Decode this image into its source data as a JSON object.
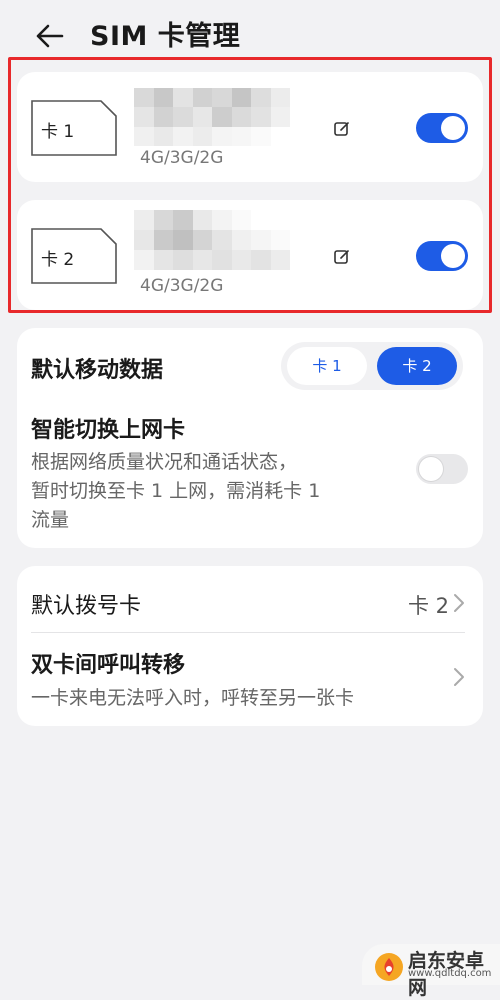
{
  "header": {
    "title": "SIM 卡管理"
  },
  "sims": [
    {
      "chip_label": "卡 1",
      "network": "4G/3G/2G",
      "enabled": true
    },
    {
      "chip_label": "卡 2",
      "network": "4G/3G/2G",
      "enabled": true
    }
  ],
  "default_data": {
    "label": "默认移动数据",
    "options": [
      "卡 1",
      "卡 2"
    ],
    "selected": "卡 2"
  },
  "smart_switch": {
    "title": "智能切换上网卡",
    "desc_line1": "根据网络质量状况和通话状态，",
    "desc_line2": "暂时切换至卡 1 上网，需消耗卡 1",
    "desc_line3": "流量",
    "enabled": false
  },
  "default_dial": {
    "label": "默认拨号卡",
    "value": "卡 2"
  },
  "call_forward": {
    "title": "双卡间呼叫转移",
    "desc": "一卡来电无法呼入时，呼转至另一张卡"
  },
  "watermark": {
    "title": "启东安卓网",
    "url": "www.qdltdq.com"
  },
  "colors": {
    "accent": "#1e5ce6",
    "highlight": "#e8292b",
    "background": "#f2f2f4"
  }
}
